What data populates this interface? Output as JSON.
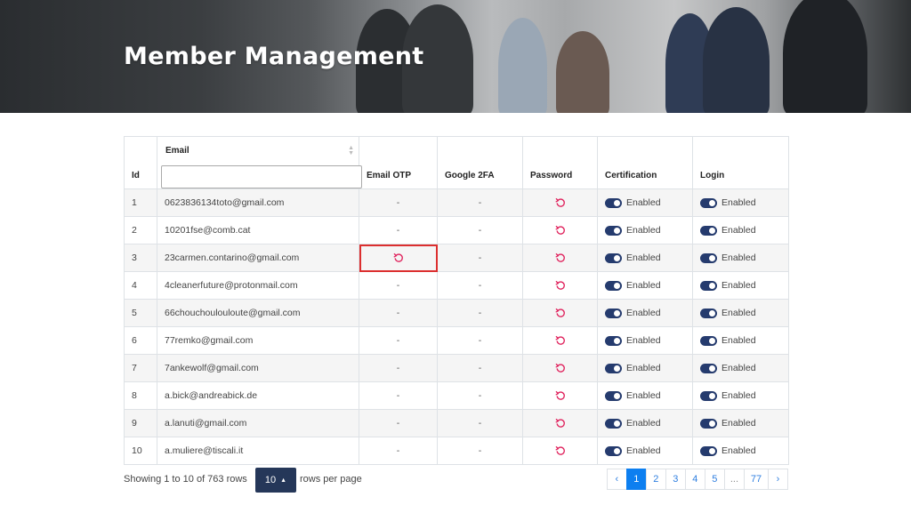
{
  "hero": {
    "title": "Member Management"
  },
  "table": {
    "headers": {
      "id": "Id",
      "email": "Email",
      "email_otp": "Email OTP",
      "google_2fa": "Google 2FA",
      "password": "Password",
      "certification": "Certification",
      "login": "Login"
    },
    "email_filter_value": "",
    "rows": [
      {
        "id": "1",
        "email": "0623836134toto@gmail.com",
        "email_otp": "-",
        "google_2fa": "-",
        "certification": "Enabled",
        "login": "Enabled"
      },
      {
        "id": "2",
        "email": "10201fse@comb.cat",
        "email_otp": "-",
        "google_2fa": "-",
        "certification": "Enabled",
        "login": "Enabled"
      },
      {
        "id": "3",
        "email": "23carmen.contarino@gmail.com",
        "email_otp": "reset-icon",
        "google_2fa": "-",
        "certification": "Enabled",
        "login": "Enabled"
      },
      {
        "id": "4",
        "email": "4cleanerfuture@protonmail.com",
        "email_otp": "-",
        "google_2fa": "-",
        "certification": "Enabled",
        "login": "Enabled"
      },
      {
        "id": "5",
        "email": "66chouchoulouloute@gmail.com",
        "email_otp": "-",
        "google_2fa": "-",
        "certification": "Enabled",
        "login": "Enabled"
      },
      {
        "id": "6",
        "email": "77remko@gmail.com",
        "email_otp": "-",
        "google_2fa": "-",
        "certification": "Enabled",
        "login": "Enabled"
      },
      {
        "id": "7",
        "email": "7ankewolf@gmail.com",
        "email_otp": "-",
        "google_2fa": "-",
        "certification": "Enabled",
        "login": "Enabled"
      },
      {
        "id": "8",
        "email": "a.bick@andreabick.de",
        "email_otp": "-",
        "google_2fa": "-",
        "certification": "Enabled",
        "login": "Enabled"
      },
      {
        "id": "9",
        "email": "a.lanuti@gmail.com",
        "email_otp": "-",
        "google_2fa": "-",
        "certification": "Enabled",
        "login": "Enabled"
      },
      {
        "id": "10",
        "email": "a.muliere@tiscali.it",
        "email_otp": "-",
        "google_2fa": "-",
        "certification": "Enabled",
        "login": "Enabled"
      }
    ]
  },
  "footer": {
    "showing_text": "Showing 1 to 10 of 763 rows",
    "rows_per_page_value": "10",
    "rows_per_page_label": "rows per page",
    "pagination": {
      "prev": "‹",
      "pages": [
        "1",
        "2",
        "3",
        "4",
        "5"
      ],
      "ellipsis": "...",
      "last": "77",
      "next": "›",
      "active_page": "1"
    }
  },
  "colors": {
    "reset_icon": "#e0245e",
    "toggle_on": "#253b6e",
    "highlight_border": "#dc2f2f",
    "active_page": "#0d7ff0",
    "rows_select_bg": "#253759"
  },
  "icons": {
    "reset": "reset-icon",
    "toggle": "toggle-switch-icon",
    "sort": "sort-caret-icon",
    "rows_select_caret": "caret-up-icon"
  }
}
